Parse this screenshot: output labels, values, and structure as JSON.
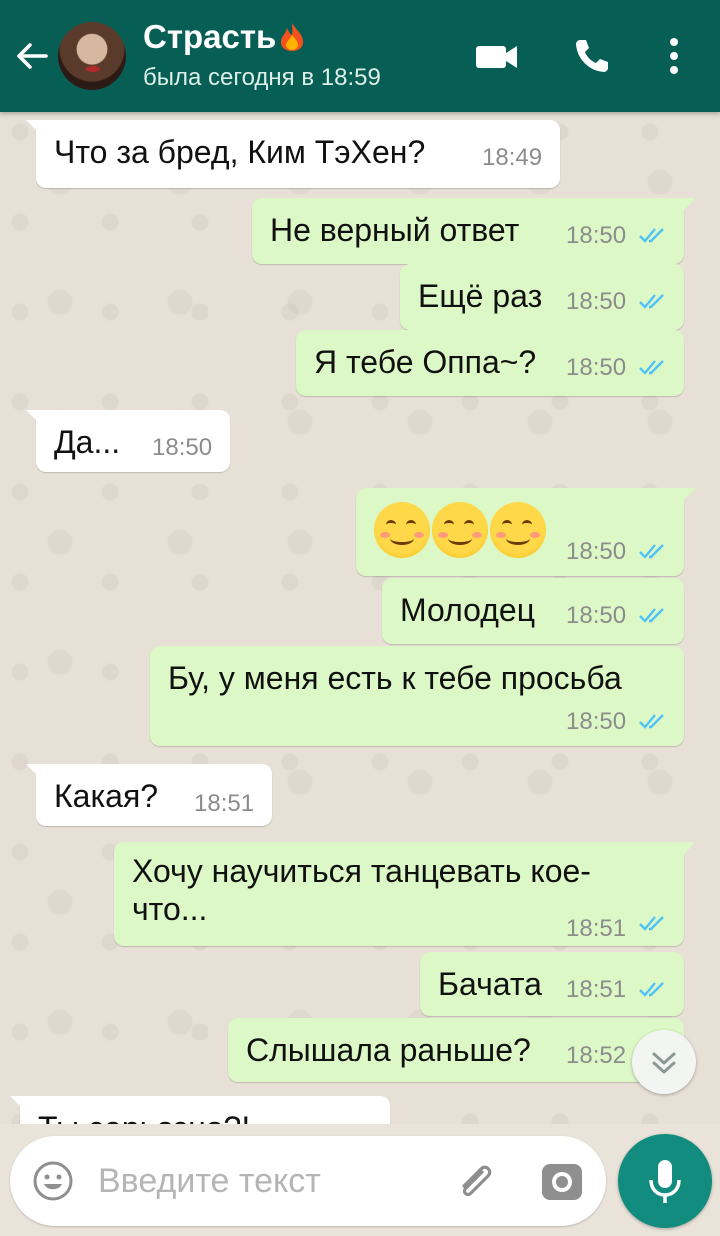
{
  "header": {
    "contact_name": "Страсть",
    "last_seen": "была сегодня в 18:59",
    "bg_color": "#075e54"
  },
  "messages": [
    {
      "dir": "in",
      "text": "Что за бред, Ким ТэХен?",
      "time": "18:49"
    },
    {
      "dir": "out",
      "text": "Не верный ответ",
      "time": "18:50",
      "status": "read"
    },
    {
      "dir": "out",
      "text": "Ещё раз",
      "time": "18:50",
      "status": "read"
    },
    {
      "dir": "out",
      "text": "Я тебе Оппа~?",
      "time": "18:50",
      "status": "read"
    },
    {
      "dir": "in",
      "text": "Да...",
      "time": "18:50"
    },
    {
      "dir": "out",
      "text": "",
      "emoji": [
        "smiling-face-emoji",
        "smiling-face-emoji",
        "smiling-face-emoji"
      ],
      "time": "18:50",
      "status": "read"
    },
    {
      "dir": "out",
      "text": "Молодец",
      "time": "18:50",
      "status": "read"
    },
    {
      "dir": "out",
      "text": "Бу, у меня есть к тебе просьба",
      "time": "18:50",
      "status": "read"
    },
    {
      "dir": "in",
      "text": "Какая?",
      "time": "18:51"
    },
    {
      "dir": "out",
      "text_line1": "Хочу научиться танцевать кое-",
      "text_line2": "что...",
      "time": "18:51",
      "status": "read"
    },
    {
      "dir": "out",
      "text": "Бачата",
      "time": "18:51",
      "status": "read"
    },
    {
      "dir": "out",
      "text": "Слышала раньше?",
      "time": "18:52",
      "status": "read"
    },
    {
      "dir": "in",
      "text": "Ты серьезно?!",
      "time": "",
      "partial": true
    }
  ],
  "composer": {
    "placeholder": "Введите текст"
  },
  "colors": {
    "incoming": "#ffffff",
    "outgoing": "#dcf8c6",
    "read_ticks": "#4fc3f7",
    "accent": "#128c7e"
  }
}
